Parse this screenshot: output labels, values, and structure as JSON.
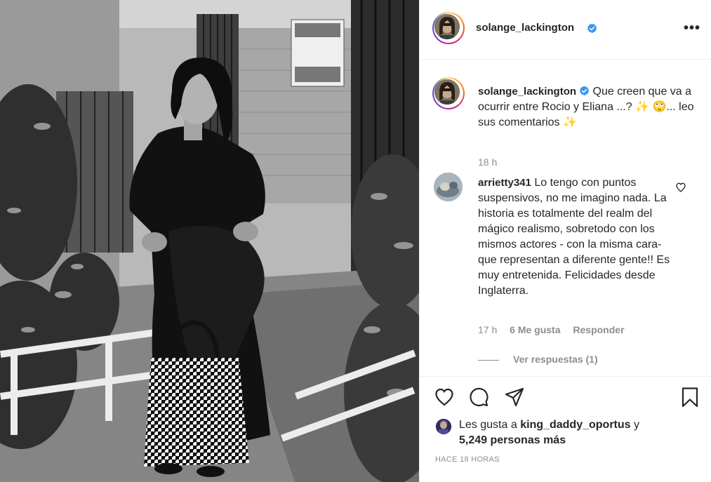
{
  "post": {
    "username": "solange_lackington",
    "verified": true,
    "more_icon": "more-horizontal-icon",
    "photo_alt": ""
  },
  "caption": {
    "username": "solange_lackington",
    "text": "Que creen que va a ocurrir entre Rocio y Eliana ...? ✨ 🙄... leo sus comentarios ✨",
    "time": "18 h"
  },
  "comment": {
    "username": "arrietty341",
    "text": "Lo tengo con puntos suspensivos, no me imagino nada. La historia es totalmente del realm del mágico realismo, sobretodo con los mismos actores - con la misma cara- que representan a diferente gente!! Es muy entretenida. Felicidades desde Inglaterra.",
    "time": "17 h",
    "likes": "6 Me gusta",
    "reply": "Responder",
    "view_replies": "Ver respuestas (1)"
  },
  "actions": {
    "like_icon": "heart-icon",
    "comment_icon": "comment-icon",
    "share_icon": "send-icon",
    "save_icon": "bookmark-icon"
  },
  "likes": {
    "prefix": "Les gusta a",
    "user": "king_daddy_oportus",
    "connector": "y",
    "others": "5,249 personas más"
  },
  "timestamp": "HACE 18 HORAS",
  "colors": {
    "verified": "#3897f0",
    "text": "#262626",
    "muted": "#8e8e8e",
    "border": "#efefef"
  }
}
